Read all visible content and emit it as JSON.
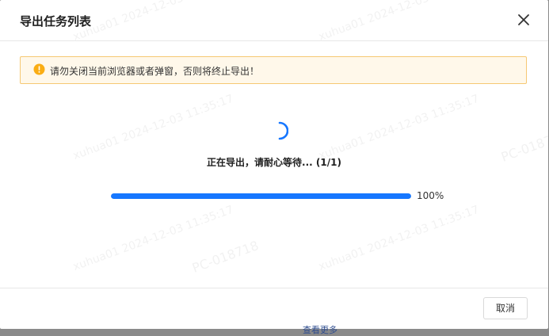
{
  "dialog": {
    "title": "导出任务列表",
    "alert_text": "请勿关闭当前浏览器或者弹窗，否则将终止导出！",
    "status_text": "正在导出，请耐心等待...  (1/1)",
    "progress": {
      "percent_label": "100%",
      "fraction": 1.0
    },
    "cancel_label": "取消"
  },
  "background": {
    "peek_text": "查看更多"
  },
  "watermark": {
    "user_stamp": "xuhua01 2024-12-03 11:35:17",
    "device": "PC-018718"
  },
  "colors": {
    "accent": "#1677ff",
    "warning": "#faad14",
    "warning_bg": "#fff8ea",
    "warning_border": "#f6c873"
  },
  "icons": {
    "close": "close-icon",
    "alert": "exclamation-circle-icon",
    "spinner": "loading-spinner-icon"
  }
}
